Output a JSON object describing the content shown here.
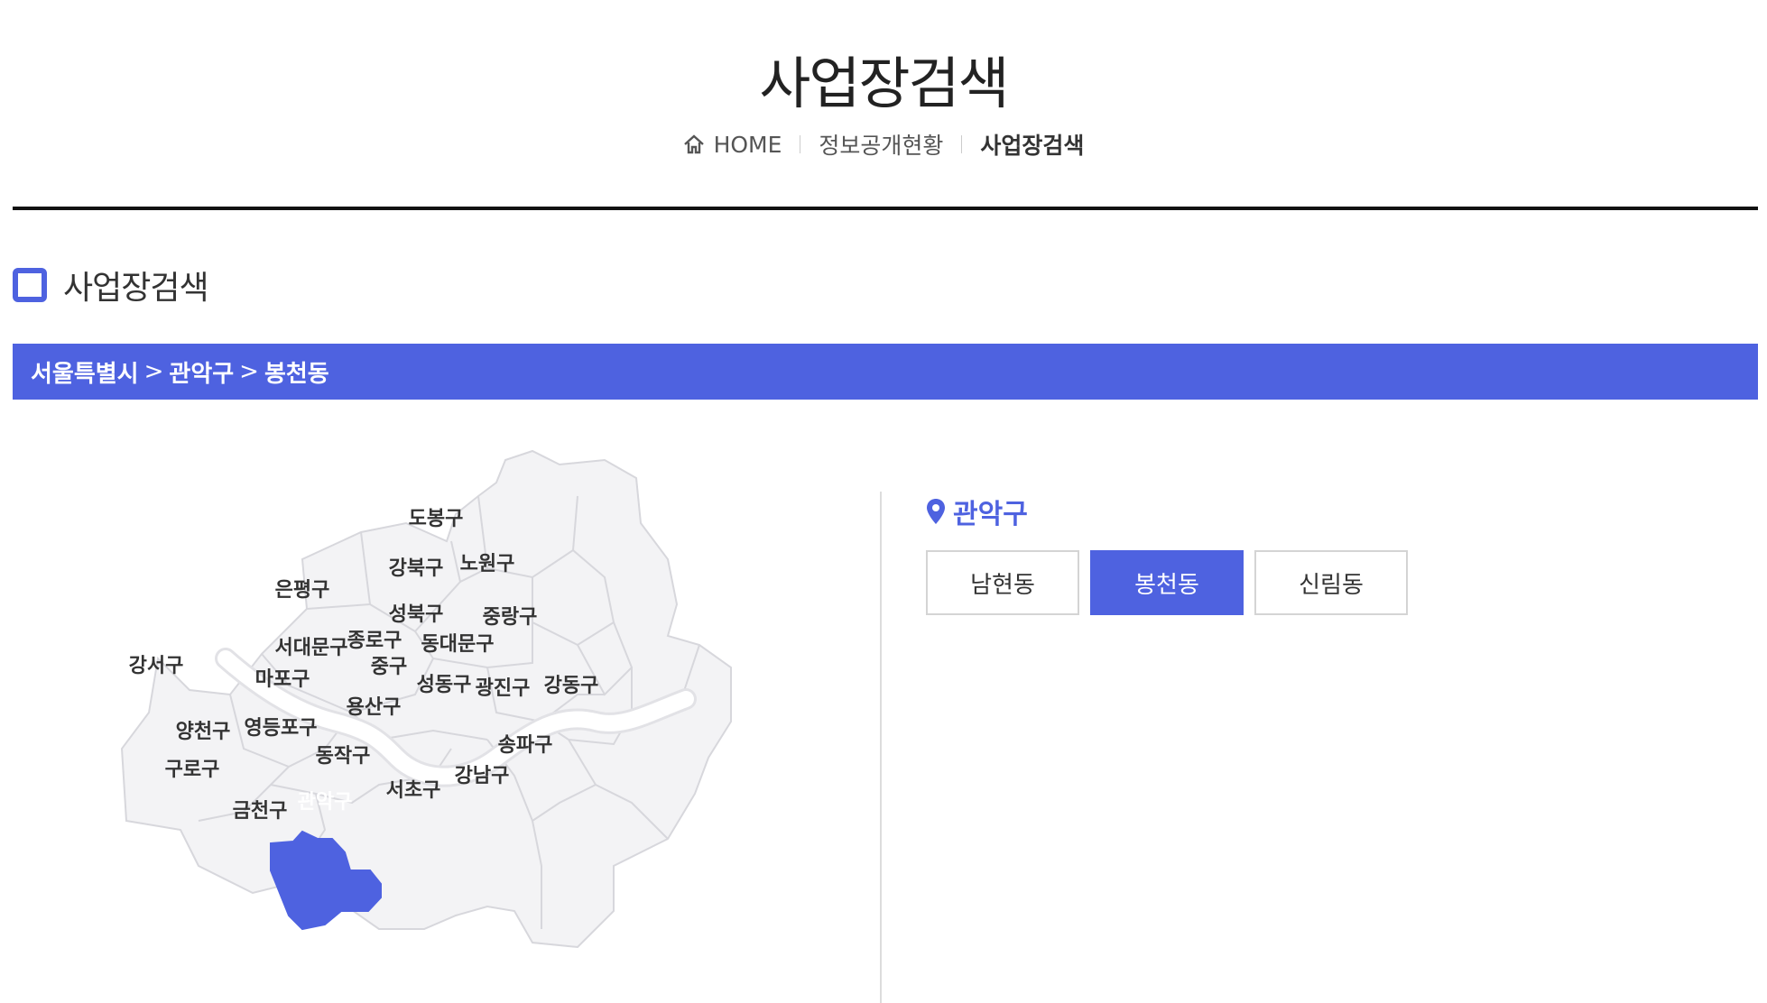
{
  "page": {
    "title": "사업장검색"
  },
  "breadcrumb": {
    "home": "HOME",
    "parent": "정보공개현황",
    "current": "사업장검색"
  },
  "section": {
    "title": "사업장검색"
  },
  "location": {
    "city": "서울특별시",
    "gu": "관악구",
    "dong": "봉천동",
    "separator": ">"
  },
  "map": {
    "districts": [
      {
        "name": "도봉구",
        "key": "dobong"
      },
      {
        "name": "노원구",
        "key": "nowon"
      },
      {
        "name": "강북구",
        "key": "gangbuk"
      },
      {
        "name": "은평구",
        "key": "eunpyeong"
      },
      {
        "name": "성북구",
        "key": "seongbuk"
      },
      {
        "name": "중랑구",
        "key": "jungnang"
      },
      {
        "name": "종로구",
        "key": "jongno"
      },
      {
        "name": "서대문구",
        "key": "seodaemun"
      },
      {
        "name": "동대문구",
        "key": "dongdaemun"
      },
      {
        "name": "강서구",
        "key": "gangseo"
      },
      {
        "name": "중구",
        "key": "jung"
      },
      {
        "name": "마포구",
        "key": "mapo"
      },
      {
        "name": "성동구",
        "key": "seongdong"
      },
      {
        "name": "광진구",
        "key": "gwangjin"
      },
      {
        "name": "강동구",
        "key": "gangdong"
      },
      {
        "name": "용산구",
        "key": "yongsan"
      },
      {
        "name": "양천구",
        "key": "yangcheon"
      },
      {
        "name": "영등포구",
        "key": "yeongdeungpo"
      },
      {
        "name": "송파구",
        "key": "songpa"
      },
      {
        "name": "동작구",
        "key": "dongjak"
      },
      {
        "name": "구로구",
        "key": "guro"
      },
      {
        "name": "강남구",
        "key": "gangnam"
      },
      {
        "name": "서초구",
        "key": "seocho"
      },
      {
        "name": "관악구",
        "key": "gwanak",
        "selected": true
      },
      {
        "name": "금천구",
        "key": "geumcheon"
      }
    ]
  },
  "panel": {
    "gu": "관악구",
    "dongs": [
      {
        "label": "남현동",
        "active": false
      },
      {
        "label": "봉천동",
        "active": true
      },
      {
        "label": "신림동",
        "active": false
      }
    ]
  },
  "colors": {
    "accent": "#4e62e0",
    "map_fill": "#f3f3f5"
  }
}
